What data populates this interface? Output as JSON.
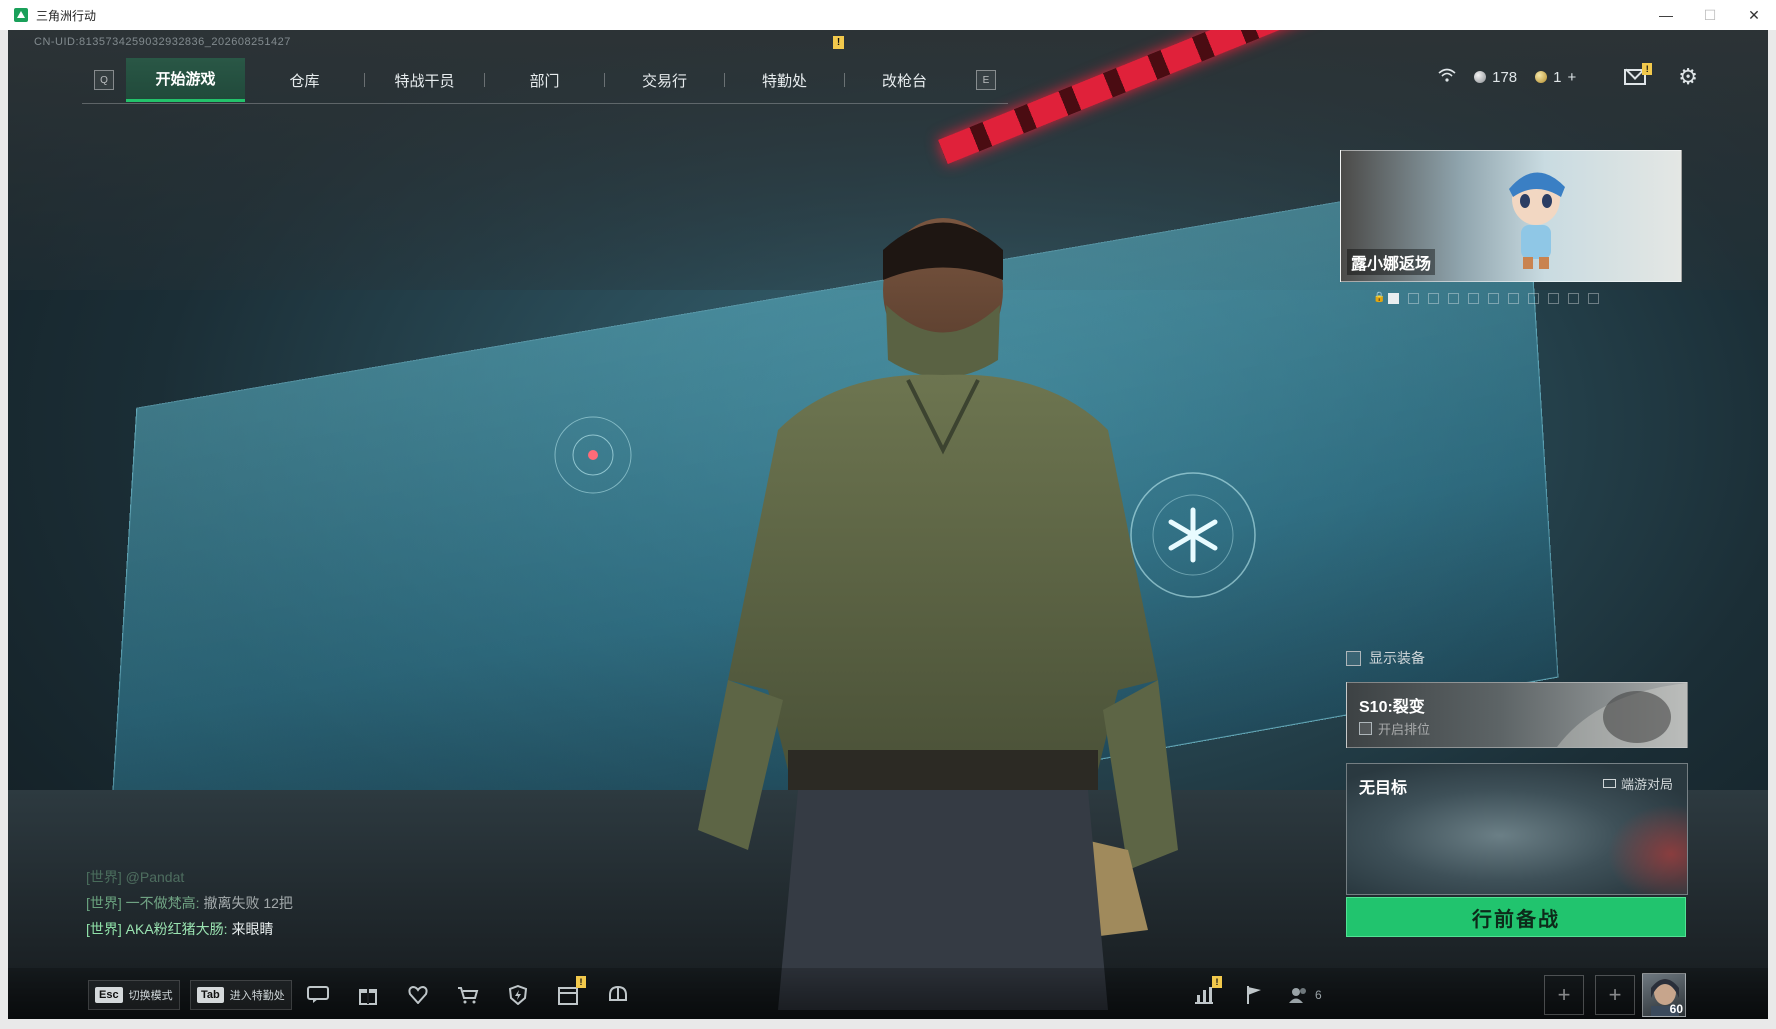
{
  "window": {
    "title": "三角洲行动",
    "controls": [
      "—",
      "☐",
      "✕"
    ]
  },
  "uid_text": "CN-UID:8135734259032932836_202608251427",
  "nav": {
    "left_key": "Q",
    "right_key": "E",
    "tabs": [
      {
        "label": "开始游戏",
        "active": true
      },
      {
        "label": "仓库"
      },
      {
        "label": "特战干员"
      },
      {
        "label": "部门"
      },
      {
        "label": "交易行"
      },
      {
        "label": "特勤处",
        "badge": "!"
      },
      {
        "label": "改枪台"
      }
    ]
  },
  "top_right": {
    "currency_1": "178",
    "currency_2": "1",
    "plus": "+",
    "mail_badge": "!",
    "icons": [
      "wifi-icon",
      "mail-icon",
      "gear-icon"
    ]
  },
  "banner": {
    "label": "露小娜返场",
    "dot_count": 11,
    "active_dot": 0
  },
  "show_gear_label": "显示装备",
  "season": {
    "title": "S10:裂变",
    "ranked_label": "开启排位"
  },
  "map_card": {
    "title": "无目标",
    "mode": "端游对局"
  },
  "prep_button": "行前备战",
  "chat": [
    {
      "channel": "[世界]",
      "name": "@Pandat",
      "message": "",
      "style": "faded"
    },
    {
      "channel": "[世界]",
      "name": "一不做梵高:",
      "message": "撤离失败 12把",
      "style": "mid"
    },
    {
      "channel": "[世界]",
      "name": "AKA粉红猪大肠:",
      "message": "来眼睛",
      "style": "normal"
    }
  ],
  "bottom_bar": {
    "hotkeys": [
      {
        "key": "Esc",
        "label": "切换模式"
      },
      {
        "key": "Tab",
        "label": "进入特勤处"
      }
    ],
    "icons": [
      "chat-icon",
      "gift-icon",
      "heart-icon",
      "shop-icon",
      "shield-bolt-icon",
      "calendar-icon",
      "helmet-icon"
    ],
    "calendar_badge": "!",
    "stats_badge": "!",
    "friend_count": "6",
    "avatar_level": "60",
    "plus": "+"
  },
  "colors": {
    "accent_green": "#23c26b",
    "badge_yellow": "#f2c94c",
    "stripe_red": "#e0213a"
  }
}
